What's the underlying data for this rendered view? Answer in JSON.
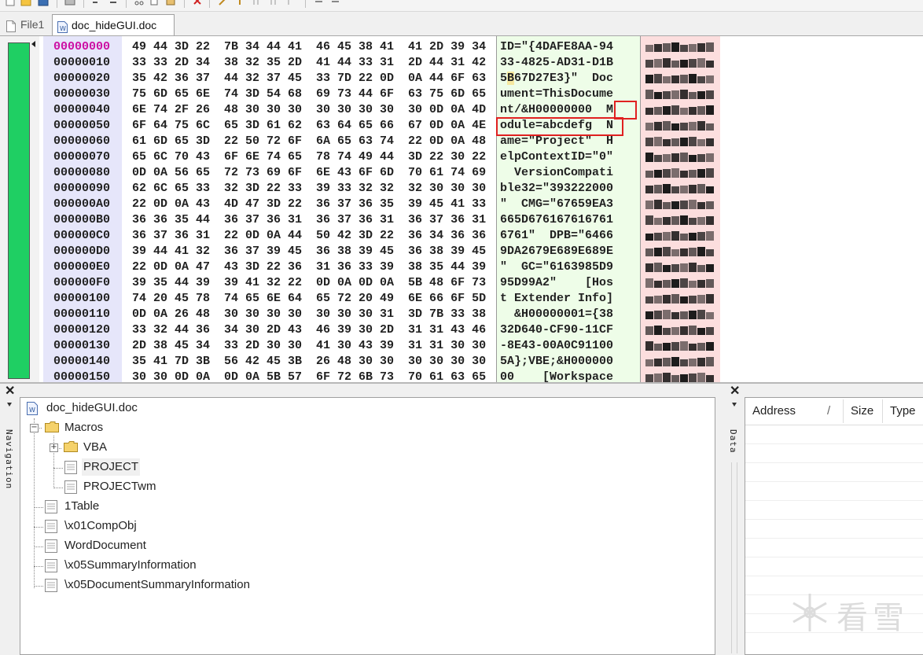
{
  "tabs": [
    {
      "label": "File1",
      "active": false
    },
    {
      "label": "doc_hideGUI.doc",
      "active": true
    }
  ],
  "hex": {
    "rows": [
      {
        "addr": "00000000",
        "hex": "49 44 3D 22  7B 34 44 41  46 45 38 41  41 2D 39 34",
        "ascii": "ID=\"{4DAFE8AA-94"
      },
      {
        "addr": "00000010",
        "hex": "33 33 2D 34  38 32 35 2D  41 44 33 31  2D 44 31 42",
        "ascii": "33-4825-AD31-D1B"
      },
      {
        "addr": "00000020",
        "hex": "35 42 36 37  44 32 37 45  33 7D 22 0D  0A 44 6F 63",
        "ascii": "5B67D27E3}\"  Doc"
      },
      {
        "addr": "00000030",
        "hex": "75 6D 65 6E  74 3D 54 68  69 73 44 6F  63 75 6D 65",
        "ascii": "ument=ThisDocume"
      },
      {
        "addr": "00000040",
        "hex": "6E 74 2F 26  48 30 30 30  30 30 30 30  30 0D 0A 4D",
        "ascii": "nt/&H00000000  M"
      },
      {
        "addr": "00000050",
        "hex": "6F 64 75 6C  65 3D 61 62  63 64 65 66  67 0D 0A 4E",
        "ascii": "odule=abcdefg  N"
      },
      {
        "addr": "00000060",
        "hex": "61 6D 65 3D  22 50 72 6F  6A 65 63 74  22 0D 0A 48",
        "ascii": "ame=\"Project\"  H"
      },
      {
        "addr": "00000070",
        "hex": "65 6C 70 43  6F 6E 74 65  78 74 49 44  3D 22 30 22",
        "ascii": "elpContextID=\"0\""
      },
      {
        "addr": "00000080",
        "hex": "0D 0A 56 65  72 73 69 6F  6E 43 6F 6D  70 61 74 69",
        "ascii": "  VersionCompati"
      },
      {
        "addr": "00000090",
        "hex": "62 6C 65 33  32 3D 22 33  39 33 32 32  32 30 30 30",
        "ascii": "ble32=\"393222000"
      },
      {
        "addr": "000000A0",
        "hex": "22 0D 0A 43  4D 47 3D 22  36 37 36 35  39 45 41 33",
        "ascii": "\"  CMG=\"67659EA3"
      },
      {
        "addr": "000000B0",
        "hex": "36 36 35 44  36 37 36 31  36 37 36 31  36 37 36 31",
        "ascii": "665D676167616761"
      },
      {
        "addr": "000000C0",
        "hex": "36 37 36 31  22 0D 0A 44  50 42 3D 22  36 34 36 36",
        "ascii": "6761\"  DPB=\"6466"
      },
      {
        "addr": "000000D0",
        "hex": "39 44 41 32  36 37 39 45  36 38 39 45  36 38 39 45",
        "ascii": "9DA2679E689E689E"
      },
      {
        "addr": "000000E0",
        "hex": "22 0D 0A 47  43 3D 22 36  31 36 33 39  38 35 44 39",
        "ascii": "\"  GC=\"6163985D9"
      },
      {
        "addr": "000000F0",
        "hex": "39 35 44 39  39 41 32 22  0D 0A 0D 0A  5B 48 6F 73",
        "ascii": "95D99A2\"    [Hos"
      },
      {
        "addr": "00000100",
        "hex": "74 20 45 78  74 65 6E 64  65 72 20 49  6E 66 6F 5D",
        "ascii": "t Extender Info]"
      },
      {
        "addr": "00000110",
        "hex": "0D 0A 26 48  30 30 30 30  30 30 30 31  3D 7B 33 38",
        "ascii": "  &H00000001={38"
      },
      {
        "addr": "00000120",
        "hex": "33 32 44 36  34 30 2D 43  46 39 30 2D  31 31 43 46",
        "ascii": "32D640-CF90-11CF"
      },
      {
        "addr": "00000130",
        "hex": "2D 38 45 34  33 2D 30 30  41 30 43 39  31 31 30 30",
        "ascii": "-8E43-00A0C91100"
      },
      {
        "addr": "00000140",
        "hex": "35 41 7D 3B  56 42 45 3B  26 48 30 30  30 30 30 30",
        "ascii": "5A};VBE;&H000000"
      },
      {
        "addr": "00000150",
        "hex": "30 30 0D 0A  0D 0A 5B 57  6F 72 6B 73  70 61 63 65",
        "ascii": "00    [Workspace"
      }
    ]
  },
  "navigation": {
    "panel_label": "Navigation",
    "tree": [
      {
        "label": "doc_hideGUI.doc"
      },
      {
        "label": "Macros"
      },
      {
        "label": "VBA"
      },
      {
        "label": "PROJECT",
        "selected": true
      },
      {
        "label": "PROJECTwm"
      },
      {
        "label": "1Table"
      },
      {
        "label": "\\x01CompObj"
      },
      {
        "label": "WordDocument"
      },
      {
        "label": "\\x05SummaryInformation"
      },
      {
        "label": "\\x05DocumentSummaryInformation"
      }
    ]
  },
  "data_panel": {
    "panel_label": "Data",
    "columns": [
      "Address",
      "Size",
      "Type"
    ],
    "sort_glyph": "/"
  },
  "watermark": {
    "text": "看雪"
  },
  "colors": {
    "address_bg": "#e6e6fa",
    "ascii_bg": "#eefde8",
    "glyph_bg": "#fcdede",
    "progress_green": "#1fcf63",
    "first_address": "#cc0fa3",
    "highlight_box": "#e02020"
  },
  "icons": [
    "file-icon",
    "word-doc-icon",
    "folder-icon",
    "stream-icon",
    "close-icon",
    "pin-icon"
  ]
}
